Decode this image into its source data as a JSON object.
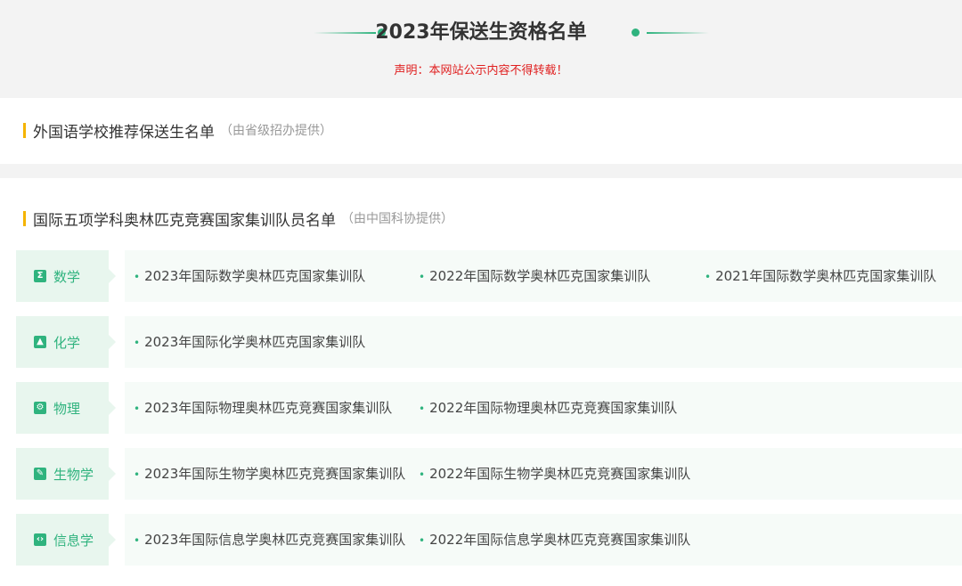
{
  "header": {
    "title": "2023年保送生资格名单",
    "notice": "声明：本网站公示内容不得转载！",
    "accent_color": "#2fb37e",
    "notice_color": "#e02020"
  },
  "section1": {
    "title": "外国语学校推荐保送生名单",
    "note": "（由省级招办提供）"
  },
  "section2": {
    "title": "国际五项学科奥林匹克竞赛国家集训队员名单",
    "note": "（由中国科协提供）",
    "subjects": [
      {
        "label": "数学",
        "icon": "sigma-icon",
        "icon_glyph": "Σ",
        "links": [
          "2023年国际数学奥林匹克国家集训队",
          "2022年国际数学奥林匹克国家集训队",
          "2021年国际数学奥林匹克国家集训队"
        ]
      },
      {
        "label": "化学",
        "icon": "flask-icon",
        "icon_glyph": "▲",
        "links": [
          "2023年国际化学奥林匹克国家集训队"
        ]
      },
      {
        "label": "物理",
        "icon": "atom-icon",
        "icon_glyph": "⚙",
        "links": [
          "2023年国际物理奥林匹克竞赛国家集训队",
          "2022年国际物理奥林匹克竞赛国家集训队"
        ]
      },
      {
        "label": "生物学",
        "icon": "leaf-icon",
        "icon_glyph": "✎",
        "links": [
          "2023年国际生物学奥林匹克竞赛国家集训队",
          "2022年国际生物学奥林匹克竞赛国家集训队"
        ]
      },
      {
        "label": "信息学",
        "icon": "code-icon",
        "icon_glyph": "‹›",
        "links": [
          "2023年国际信息学奥林匹克竞赛国家集训队",
          "2022年国际信息学奥林匹克竞赛国家集训队"
        ]
      }
    ]
  }
}
